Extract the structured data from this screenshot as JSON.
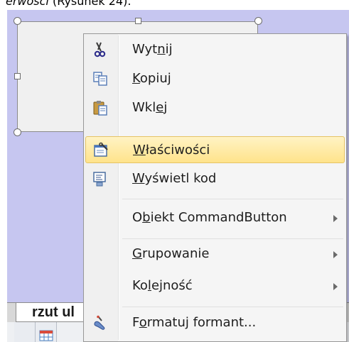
{
  "caption": {
    "visible_text": "erwosci",
    "text_after": " (Rysunek 24)."
  },
  "sheet": {
    "tab_label": "rzut ul"
  },
  "colors": {
    "worksheet_bg": "#c6c6f0",
    "menu_bg": "#f5f5f5",
    "highlight_top": "#fff3c4",
    "highlight_bottom": "#ffe38b",
    "highlight_border": "#e5c365"
  },
  "context_menu": {
    "items": [
      {
        "label": "Wytnij",
        "accel_index": 3,
        "icon": "cut-icon",
        "submenu": false,
        "highlighted": false
      },
      {
        "label": "Kopiuj",
        "accel_index": 0,
        "icon": "copy-icon",
        "submenu": false,
        "highlighted": false
      },
      {
        "label": "Wklej",
        "accel_index": 3,
        "icon": "paste-icon",
        "submenu": false,
        "highlighted": false
      },
      {
        "label": "Właściwości",
        "accel_index": 0,
        "icon": "properties-icon",
        "submenu": false,
        "highlighted": true
      },
      {
        "label": "Wyświetl kod",
        "accel_index": 0,
        "icon": "view-code-icon",
        "submenu": false,
        "highlighted": false
      },
      {
        "label": "Obiekt CommandButton",
        "accel_index": 1,
        "icon": "",
        "submenu": true,
        "highlighted": false
      },
      {
        "label": "Grupowanie",
        "accel_index": 0,
        "icon": "",
        "submenu": true,
        "highlighted": false
      },
      {
        "label": "Kolejność",
        "accel_index": 2,
        "icon": "",
        "submenu": true,
        "highlighted": false
      },
      {
        "label": "Formatuj formant...",
        "accel_index": 1,
        "icon": "format-control-icon",
        "submenu": false,
        "highlighted": false
      }
    ]
  }
}
